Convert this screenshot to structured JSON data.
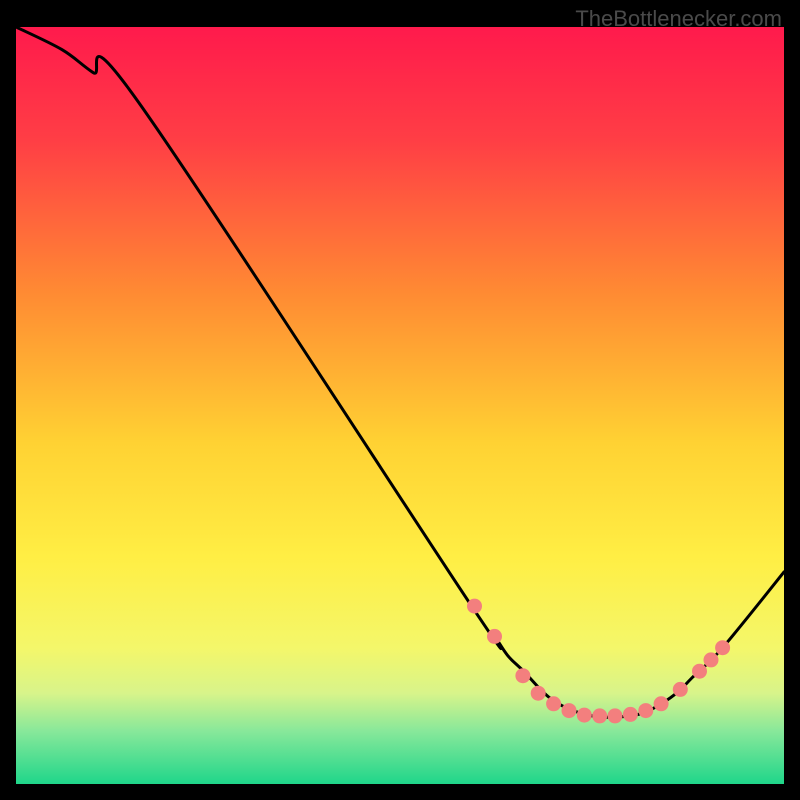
{
  "watermark": "TheBottlenecker.com",
  "chart_data": {
    "type": "line",
    "title": "",
    "xlabel": "",
    "ylabel": "",
    "xlim": [
      0,
      100
    ],
    "ylim": [
      0,
      100
    ],
    "grid": false,
    "legend": false,
    "gradient_stops": [
      {
        "pos": 0,
        "color": "#ff1a4c"
      },
      {
        "pos": 15,
        "color": "#ff3e45"
      },
      {
        "pos": 35,
        "color": "#ff8a33"
      },
      {
        "pos": 55,
        "color": "#ffd233"
      },
      {
        "pos": 70,
        "color": "#ffee44"
      },
      {
        "pos": 82,
        "color": "#f4f76a"
      },
      {
        "pos": 88,
        "color": "#d8f48a"
      },
      {
        "pos": 93,
        "color": "#88e89a"
      },
      {
        "pos": 100,
        "color": "#1fd68a"
      }
    ],
    "curve": {
      "x": [
        0,
        6,
        10,
        16,
        59,
        62,
        64,
        66,
        70,
        75,
        80,
        83,
        86,
        88,
        92,
        100
      ],
      "y": [
        100,
        97,
        94,
        90,
        24,
        20,
        17,
        15,
        11,
        9,
        9,
        10,
        12,
        14,
        18,
        28
      ]
    },
    "markers": {
      "color": "#f37f7e",
      "radius": 7.5,
      "points": [
        {
          "x": 59.7,
          "y": 23.5
        },
        {
          "x": 62.3,
          "y": 19.5
        },
        {
          "x": 66.0,
          "y": 14.3
        },
        {
          "x": 68.0,
          "y": 12.0
        },
        {
          "x": 70.0,
          "y": 10.6
        },
        {
          "x": 72.0,
          "y": 9.7
        },
        {
          "x": 74.0,
          "y": 9.1
        },
        {
          "x": 76.0,
          "y": 9.0
        },
        {
          "x": 78.0,
          "y": 9.0
        },
        {
          "x": 80.0,
          "y": 9.2
        },
        {
          "x": 82.0,
          "y": 9.7
        },
        {
          "x": 84.0,
          "y": 10.6
        },
        {
          "x": 86.5,
          "y": 12.5
        },
        {
          "x": 89.0,
          "y": 14.9
        },
        {
          "x": 90.5,
          "y": 16.4
        },
        {
          "x": 92.0,
          "y": 18.0
        }
      ]
    }
  }
}
